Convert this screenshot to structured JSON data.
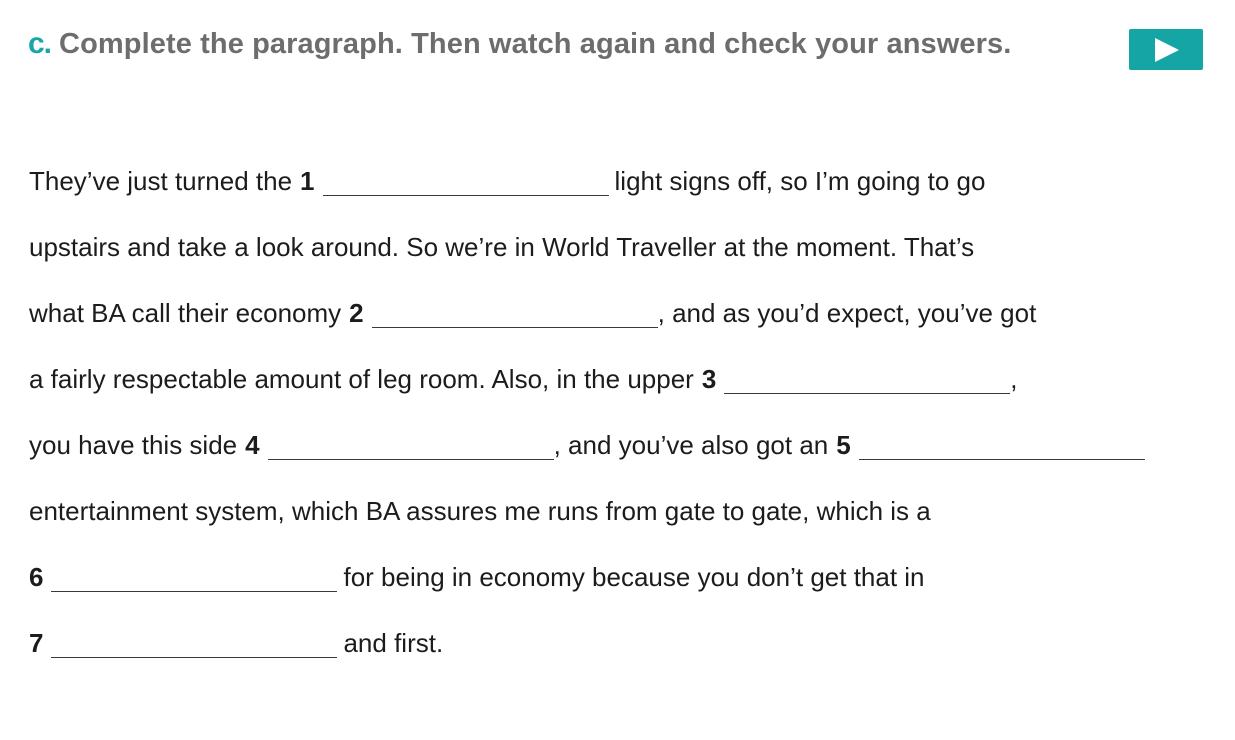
{
  "header": {
    "task_letter": "c.",
    "instruction": "Complete the paragraph. Then watch again and check your answers.",
    "play_icon": "play-icon",
    "accent_color": "#16a5a5"
  },
  "passage": {
    "lines": [
      {
        "t1": "They’ve just turned the",
        "n": "1",
        "t2": "light signs off, so I’m going to go"
      },
      {
        "t1": "upstairs and take a look around. So we’re in World Traveller at the moment. That’s"
      },
      {
        "t1": "what BA call their economy",
        "n": "2",
        "t2": ", and as you’d expect, you’ve got"
      },
      {
        "t1": "a fairly respectable amount of leg room. Also, in the upper",
        "n": "3",
        "t2": ","
      },
      {
        "t1": "you have this side",
        "n": "4",
        "t2": ", and you’ve also got an",
        "n2": "5"
      },
      {
        "t1": "entertainment system, which BA assures me runs from gate to gate, which is a"
      },
      {
        "n": "6",
        "t2": "for being in economy because you don’t get that in"
      },
      {
        "n": "7",
        "t2": "and first."
      }
    ]
  }
}
